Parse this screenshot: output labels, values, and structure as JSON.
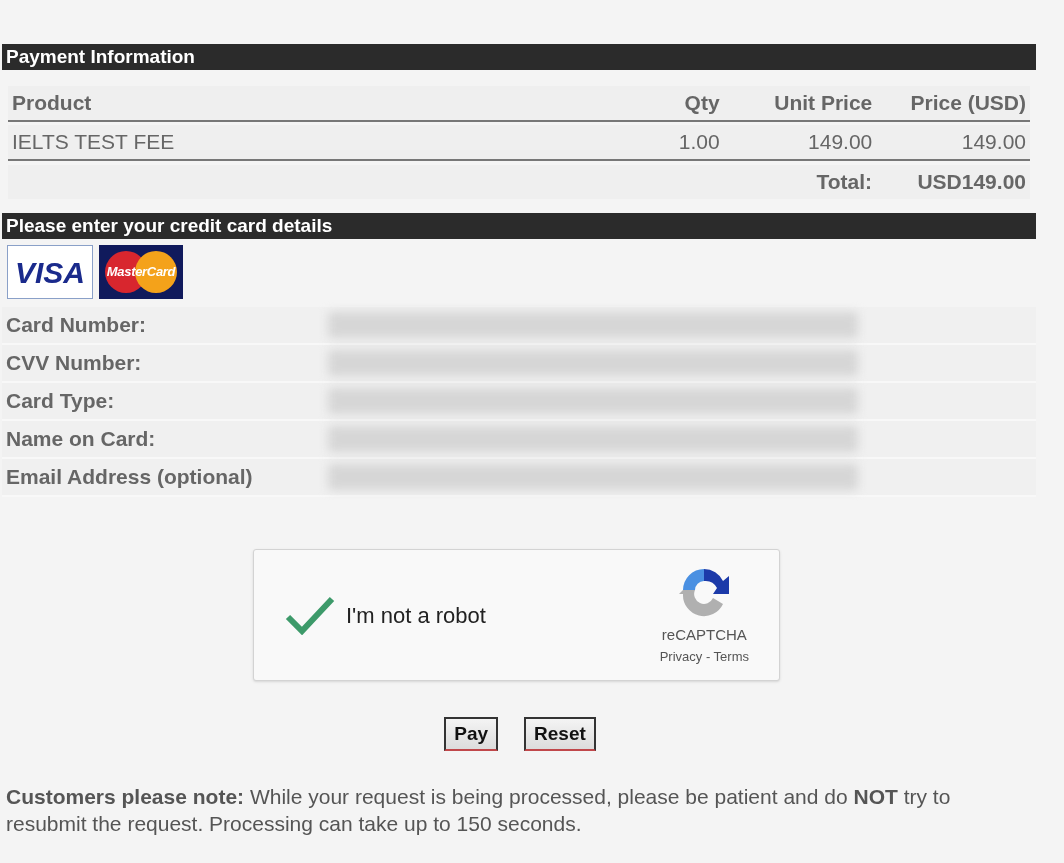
{
  "payment_information": {
    "title": "Payment Information",
    "columns": [
      "Product",
      "Qty",
      "Unit Price",
      "Price (USD)"
    ],
    "rows": [
      [
        "IELTS TEST FEE",
        "1.00",
        "149.00",
        "149.00"
      ]
    ],
    "total_label": "Total:",
    "total_value": "USD149.00"
  },
  "card_details": {
    "title": "Please enter your credit card details",
    "logos": [
      {
        "kind": "visa",
        "label": "VISA"
      },
      {
        "kind": "mastercard",
        "label": "MasterCard"
      }
    ],
    "fields": [
      {
        "label": "Card Number:",
        "redacted": true
      },
      {
        "label": "CVV Number:",
        "redacted": true
      },
      {
        "label": "Card Type:",
        "redacted": true
      },
      {
        "label": "Name on Card:",
        "redacted": true
      },
      {
        "label": "Email Address (optional)",
        "redacted": true
      }
    ]
  },
  "captcha": {
    "label": "I'm not a robot",
    "checked": true,
    "brand": "reCAPTCHA",
    "links": "Privacy - Terms"
  },
  "buttons": [
    "Pay",
    "Reset"
  ],
  "note": "**Customers please note:** While your request is being processed, please be patient and do **NOT** try to resubmit the request. Processing can take up to 150 seconds."
}
